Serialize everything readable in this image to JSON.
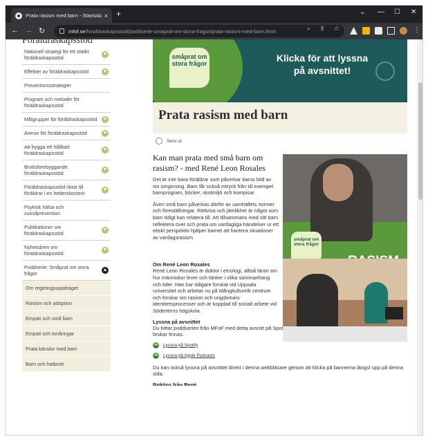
{
  "browser": {
    "tab_title": "Prata rasism med barn - Startsida",
    "tab_close": "×",
    "new_tab": "+",
    "url_host": "mfof.se",
    "url_path": "/foraldraskapsstod/poddserie-smaprat-om-stora-fragor/prata-rasism-med-barn.html",
    "win_min": "—",
    "win_max": "☐",
    "win_close": "✕",
    "tabs_menu": "⌄"
  },
  "sidebar": {
    "heading": "Föräldraskapsstöd",
    "items": [
      {
        "label": "Nationell strategi för ett stärkt föräldraskapsstöd",
        "chevron": true
      },
      {
        "label": "Effekter av föräldraskapsstöd",
        "chevron": true
      },
      {
        "label": "Preventionsstrategier",
        "chevron": false
      },
      {
        "label": "Program och metoder för föräldraskapsstöd",
        "chevron": false
      },
      {
        "label": "Målgrupper för föräldraskapsstöd",
        "chevron": true
      },
      {
        "label": "Arenor för föräldraskapsstöd",
        "chevron": true
      },
      {
        "label": "Att bygga ett hållbart föräldraskapsstöd",
        "chevron": true
      },
      {
        "label": "Brottsförebyggande föräldraskapsstöd",
        "chevron": true
      },
      {
        "label": "Föräldraskapsstöd riktat till föräldrar i en hederskontext",
        "chevron": true
      },
      {
        "label": "Psykisk hälsa och suicidprevention",
        "chevron": false
      },
      {
        "label": "Publikationer om föräldraskapsstöd",
        "chevron": true
      },
      {
        "label": "Nyhetsbrev om föräldraskapsstöd",
        "chevron": true
      },
      {
        "label": "Poddserie: Småprat om stora frågor",
        "chevron": true,
        "expanded": true
      }
    ],
    "sub_items": [
      "Om regeringsuppdraget",
      "Rasism och adoption",
      "Empati och små barn",
      "Empati och tonåringar",
      "Prata känslor med barn",
      "Barn och hatbrott"
    ]
  },
  "banner": {
    "logo_text": "småprat om stora frågor",
    "cta": "Klicka för att lyssna på avsnittet!"
  },
  "page": {
    "title": "Prata rasism med barn",
    "print_label": "Skriv ut"
  },
  "article": {
    "heading": "Kan man prata med små barn om rasism? - med René Leon Rosales",
    "p1": "Det är inte bara föräldrar som påverkar barns bild av sin omgivning. Barn får också intryck från till exempel barnprogram, böcker, skolmiljö och kompisar.",
    "p2": "Även små barn påverkas därför av samhällets normer och föreställningar. Rättvisa och jämlikhet är något som barn tidigt kan relatera till. Att tillsammans med sitt barn reflektera över och prata om vardagliga händelser ur ett etiskt perspektiv hjälper barnet att hantera situationer av vardagsrasism.",
    "image_logo": "småprat om stora frågor",
    "image_word": "RASISM"
  },
  "about": {
    "heading": "Om René Leon Rosales",
    "text": "René Leon Rosales är doktor i etnologi, alltså läran om hur människor lever och tänker i olika sammanhang och tider. Han har tidigare forskat vid Uppsala universitet och arbetar nu på Mångkulturellt centrum och forskar om rasism och ungdomars identitetsprocesser och är kopplad till socialt arbete vid Södertörns högskola."
  },
  "listen": {
    "heading": "Lyssna på avsnittet",
    "text": "Du hittar poddserien från MFoF med detta avsnitt på Spotify, Apple Podcasts och andra platser där poddar brukar finnas.",
    "links": [
      "Lyssna på Spotify",
      "Lyssna på Apple Podcasts"
    ],
    "more": "Du kan också lyssna på avsnittet direkt i denna webbläsare genom att klicka på bannerna längst upp på denna sida.",
    "cut_heading": "Boktips från René"
  }
}
